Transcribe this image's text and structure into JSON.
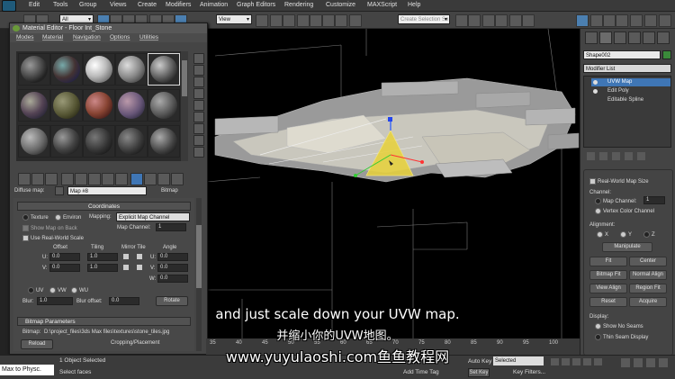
{
  "menubar": {
    "items": [
      "Edit",
      "Tools",
      "Group",
      "Views",
      "Create",
      "Modifiers",
      "Animation",
      "Graph Editors",
      "Rendering",
      "Customize",
      "MAXScript",
      "Help"
    ]
  },
  "toolbar": {
    "selection_filter": "All",
    "ref_coord": "View",
    "named_selection_placeholder": "Create Selection Se"
  },
  "material_editor": {
    "title": "Material Editor - Floor Int_Stone",
    "menus": [
      "Modes",
      "Material",
      "Navigation",
      "Options",
      "Utilities"
    ],
    "diffuse_label": "Diffuse map:",
    "map_name": "Map #8",
    "map_type": "Bitmap",
    "coordinates": {
      "title": "Coordinates",
      "texture_label": "Texture",
      "environ_label": "Environ",
      "mapping_label": "Mapping:",
      "mapping_value": "Explicit Map Channel",
      "show_map_on_back": "Show Map on Back",
      "map_channel_label": "Map Channel:",
      "map_channel_value": "1",
      "use_real_world": "Use Real-World Scale",
      "col_offset": "Offset",
      "col_tiling": "Tiling",
      "col_mirror_tile": "Mirror Tile",
      "col_angle": "Angle",
      "u_label": "U:",
      "v_label": "V:",
      "w_label": "W:",
      "u_offset": "0.0",
      "v_offset": "0.0",
      "u_tiling": "1.0",
      "v_tiling": "1.0",
      "u_angle": "0.0",
      "v_angle": "0.0",
      "w_angle": "0.0",
      "uv": "UV",
      "vw": "VW",
      "wu": "WU",
      "blur_label": "Blur:",
      "blur_value": "1.0",
      "blur_offset_label": "Blur offset:",
      "blur_offset_value": "0.0",
      "rotate": "Rotate"
    },
    "bitmap_params": {
      "title": "Bitmap Parameters",
      "bitmap_label": "Bitmap:",
      "bitmap_path": "D:\\project_files\\3ds Max files\\textures\\stone_tiles.jpg",
      "reload": "Reload",
      "cropping": "Cropping/Placement"
    }
  },
  "command_panel": {
    "object_name": "Shape002",
    "modifier_list": "Modifier List",
    "stack": [
      "UVW Map",
      "Edit Poly",
      "Editable Spline"
    ],
    "real_world_map_size": "Real-World Map Size",
    "channel_label": "Channel:",
    "map_channel_label": "Map Channel:",
    "map_channel_value": "1",
    "vertex_color_channel": "Vertex Color Channel",
    "alignment_label": "Alignment:",
    "axes": [
      "X",
      "Y",
      "Z"
    ],
    "buttons": {
      "manipulate": "Manipulate",
      "fit": "Fit",
      "center": "Center",
      "bitmap_fit": "Bitmap Fit",
      "normal_align": "Normal Align",
      "view_align": "View Align",
      "region_fit": "Region Fit",
      "reset": "Reset",
      "acquire": "Acquire"
    },
    "display_label": "Display:",
    "show_no_seams": "Show No Seams",
    "thin_seam_display": "Thin Seam Display"
  },
  "timeline": {
    "ticks": [
      "35",
      "40",
      "45",
      "50",
      "55",
      "60",
      "65",
      "70",
      "75",
      "80",
      "85",
      "90",
      "95",
      "100"
    ]
  },
  "status": {
    "max_to_physc": "Max to Physc.",
    "selected_count": "1 Object Selected",
    "prompt": "Select faces",
    "auto_key": "Auto Key",
    "set_key": "Set Key",
    "key_mode": "Selected",
    "key_filters": "Key Filters...",
    "add_time_tag": "Add Time Tag"
  },
  "subtitles": {
    "english": "and just scale down your UVW map.",
    "chinese": "并缩小你的UVW地图。",
    "watermark": "www.yuyulaoshi.com鱼鱼教程网"
  },
  "colors": {
    "accent_blue": "#3f76b5",
    "panel_gray": "#444444",
    "viewport_bg": "#000000",
    "gizmo_yellow": "#e8d13a"
  }
}
